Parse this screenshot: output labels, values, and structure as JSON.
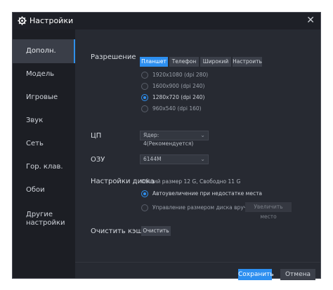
{
  "window": {
    "title": "Настройки"
  },
  "sidebar": {
    "items": [
      {
        "label": "Дополн."
      },
      {
        "label": "Модель"
      },
      {
        "label": "Игровые"
      },
      {
        "label": "Звук"
      },
      {
        "label": "Сеть"
      },
      {
        "label": "Гор. клав."
      },
      {
        "label": "Обои"
      },
      {
        "label": "Другие настройки"
      }
    ]
  },
  "resolution": {
    "label": "Разрешение",
    "tabs": [
      "Планшет",
      "Телефон",
      "Широкий",
      "Настроить"
    ],
    "active_tab": "Планшет",
    "options": [
      "1920x1080  (dpi 280)",
      "1600x900  (dpi 240)",
      "1280x720  (dpi 240)",
      "960x540  (dpi 160)"
    ],
    "selected_option": "1280x720  (dpi 240)"
  },
  "cpu": {
    "label": "ЦП",
    "value": "Ядер: 4(Рекомендуется)"
  },
  "ram": {
    "label": "ОЗУ",
    "value": "6144M"
  },
  "disk": {
    "label": "Настройки диска",
    "summary": "Общий размер 12 G,  Свободно 11 G",
    "auto_option": "Автоувеличение при недостатке места",
    "manual_option": "Управление размером диска вручную",
    "increase_button": "Увеличить место"
  },
  "cache": {
    "label": "Очистить кэш",
    "button": "Очистить"
  },
  "footer": {
    "save": "Сохранить",
    "cancel": "Отмена"
  },
  "colors": {
    "accent": "#2d8ff0",
    "background": "#272a32",
    "sidebar": "#1c1e24"
  },
  "icons": {
    "title_icon": "gear-icon",
    "close_icon": "close-icon",
    "dropdown_icon": "chevron-down-icon"
  }
}
